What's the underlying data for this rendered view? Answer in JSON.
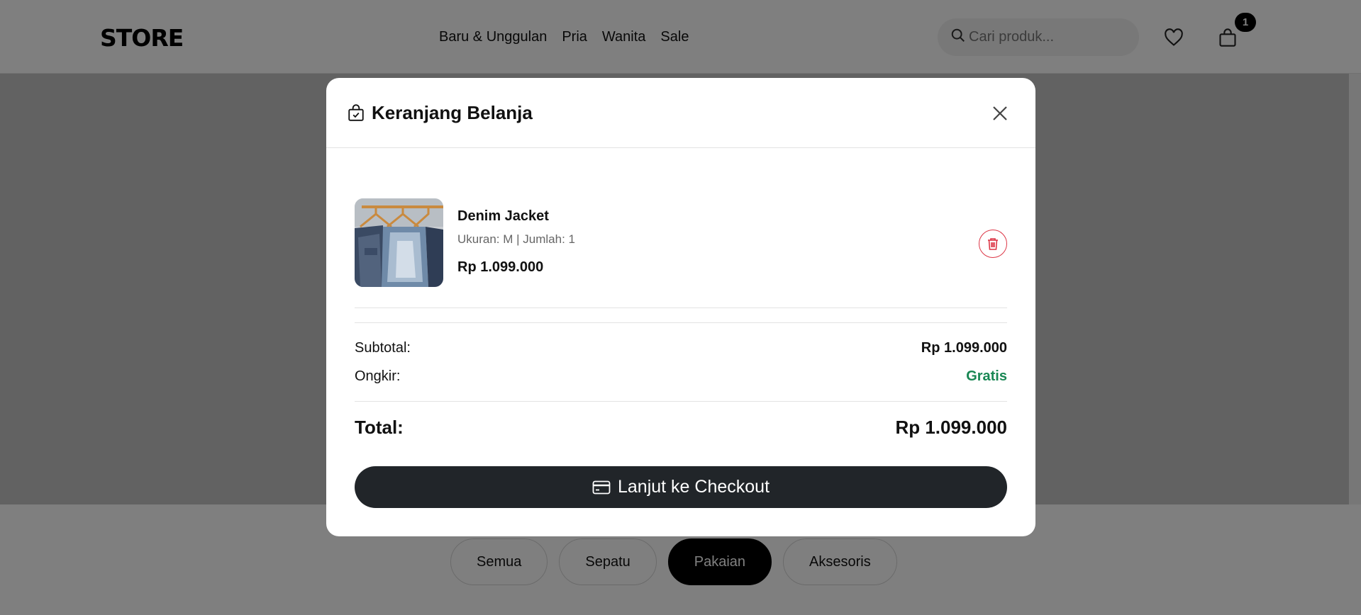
{
  "header": {
    "logo": "STORE",
    "nav": [
      "Baru & Unggulan",
      "Pria",
      "Wanita",
      "Sale"
    ],
    "search_placeholder": "Cari produk...",
    "cart_count": "1"
  },
  "categories": [
    {
      "label": "Semua",
      "active": false
    },
    {
      "label": "Sepatu",
      "active": false
    },
    {
      "label": "Pakaian",
      "active": true
    },
    {
      "label": "Aksesoris",
      "active": false
    }
  ],
  "cart": {
    "title": "Keranjang Belanja",
    "items": [
      {
        "name": "Denim Jacket",
        "meta": "Ukuran: M | Jumlah: 1",
        "price": "Rp 1.099.000"
      }
    ],
    "subtotal_label": "Subtotal:",
    "subtotal_value": "Rp 1.099.000",
    "shipping_label": "Ongkir:",
    "shipping_value": "Gratis",
    "total_label": "Total:",
    "total_value": "Rp 1.099.000",
    "checkout_label": "Lanjut ke Checkout"
  },
  "colors": {
    "accent_dark": "#212529",
    "danger": "#dc3545",
    "success": "#198754"
  },
  "icons": [
    "search-icon",
    "heart-icon",
    "shopping-bag-icon",
    "bag-check-icon",
    "close-icon",
    "trash-icon",
    "credit-card-icon"
  ]
}
